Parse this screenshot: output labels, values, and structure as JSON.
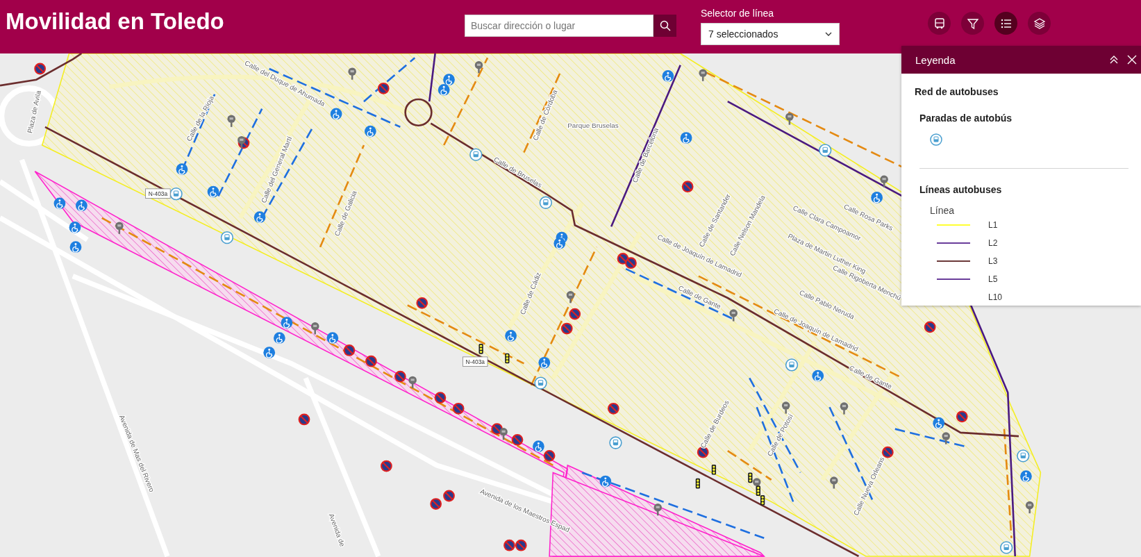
{
  "header": {
    "title": "Movilidad en Toledo",
    "search": {
      "placeholder": "Buscar dirección o lugar"
    },
    "line_selector": {
      "label": "Selector de línea",
      "value": "7 seleccionados"
    },
    "tools": [
      {
        "kind": "bus",
        "selected": false
      },
      {
        "kind": "filter",
        "selected": false
      },
      {
        "kind": "list",
        "selected": true
      },
      {
        "kind": "layers",
        "selected": false
      }
    ]
  },
  "legend": {
    "title": "Leyenda",
    "layer": "Red de autobuses",
    "groups": [
      {
        "kind": "symbol",
        "title": "Paradas de autobús"
      },
      {
        "kind": "lines",
        "title": "Líneas autobuses",
        "field": "Línea",
        "items": [
          {
            "label": "L1",
            "color": "#ffff33"
          },
          {
            "label": "L2",
            "color": "#6a3d9a"
          },
          {
            "label": "L3",
            "color": "#6b3a3a"
          },
          {
            "label": "L5",
            "color": "#6a3d9a"
          },
          {
            "label": "L10"
          }
        ]
      }
    ]
  },
  "map": {
    "labels": [
      "Calle del Duque de Ahumada",
      "Calle de la Rioja",
      "Calle del General Martí",
      "Calle de Galicia",
      "Calle de Córdoba",
      "Parque Bruselas",
      "Calle de Barcelona",
      "Calle de Bruselas",
      "Plaza de Avila",
      "Calle de Cádiz",
      "Calle de Joaquín de Lamadrid",
      "Calle de Gante",
      "Calle de Santander",
      "Calle Nelson Mandela",
      "Calle Clara Campoamor",
      "Calle Rosa Parks",
      "Plaza de Martin Luther King",
      "Calle Rigoberta Menchú",
      "Calle Pablo Neruda",
      "Calle de Joaquín de Lamadrid",
      "Calle de Gante",
      "Calle de Burdeos",
      "Calle de Potosí",
      "Calle Nueva Orleans",
      "Avenida de Mas del Rivero",
      "Avenida de los Maestros Espad",
      "Avenida de"
    ],
    "shields": [
      "N-403a",
      "N-403a"
    ]
  }
}
